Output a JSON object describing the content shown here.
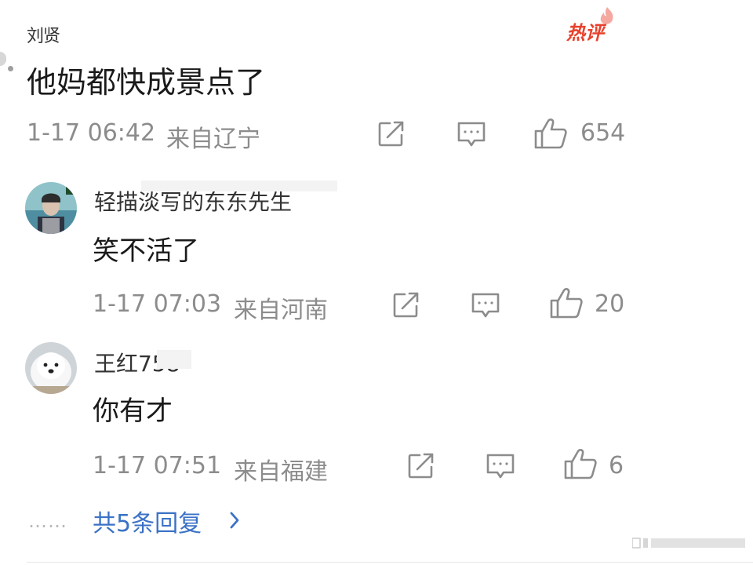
{
  "comment": {
    "author": "刘贤",
    "hot_label": "热评",
    "text": "他妈都快成景点了",
    "timestamp": "1-17 06:42",
    "location": "来自辽宁",
    "likes": "654"
  },
  "replies": [
    {
      "author": "轻描淡写的东东先生",
      "text": "笑不活了",
      "timestamp": "1-17 07:03",
      "location": "来自河南",
      "likes": "20"
    },
    {
      "author": "王红758",
      "text": "你有才",
      "timestamp": "1-17 07:51",
      "location": "来自福建",
      "likes": "6"
    }
  ],
  "more": {
    "dots": "……",
    "label": "共5条回复"
  },
  "icons": [
    "share-icon",
    "comment-icon",
    "like-icon",
    "chevron-right-icon"
  ],
  "colors": {
    "hot": "#e8412c",
    "link": "#3a72c6",
    "meta": "#8c8c8c"
  }
}
